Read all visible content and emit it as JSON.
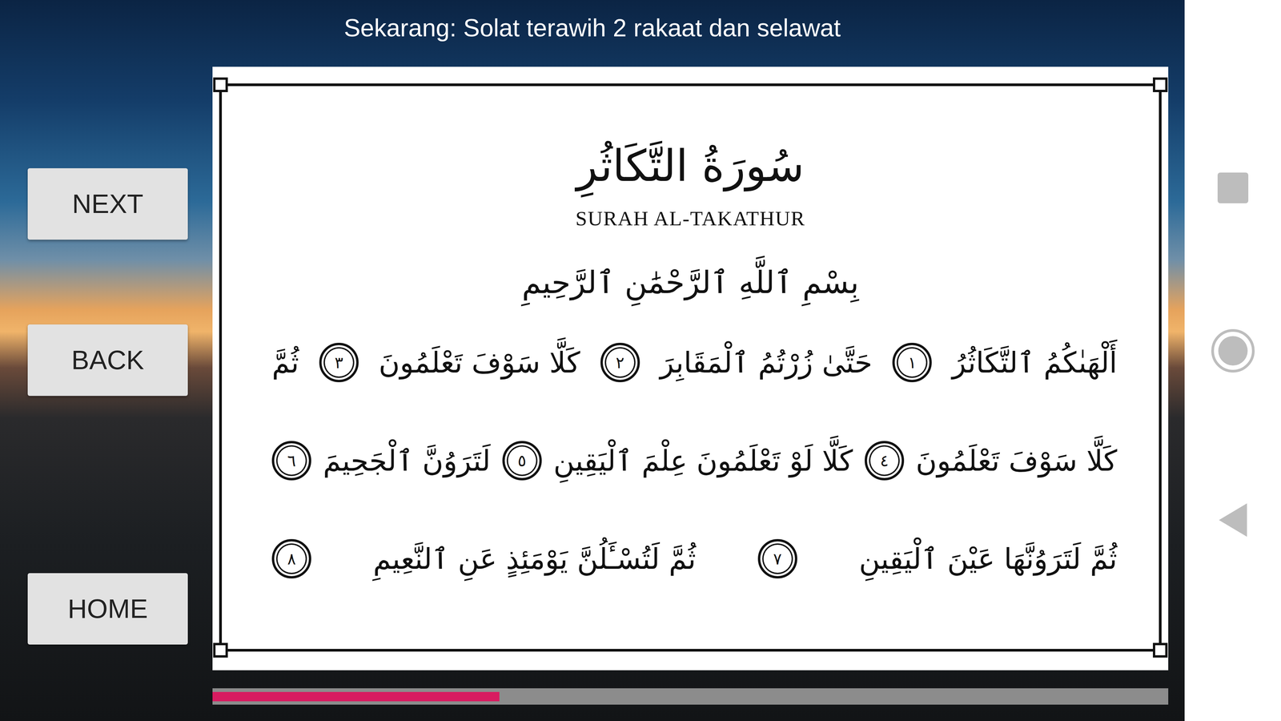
{
  "header": {
    "text": "Sekarang: Solat terawih 2 rakaat dan selawat"
  },
  "buttons": [
    "NEXT",
    "BACK",
    "HOME"
  ],
  "page": {
    "title_arabic": "سُورَةُ التَّكَاثُرِ",
    "title_latin": "SURAH AL-TAKATHUR",
    "basmala": "بِسْمِ ٱللَّهِ ٱلرَّحْمَٰنِ ٱلرَّحِيمِ",
    "lines": [
      [
        {
          "kind": "text",
          "text": "أَلْهَىٰكُمُ ٱلتَّكَاثُرُ"
        },
        {
          "kind": "number",
          "text": "١"
        },
        {
          "kind": "text",
          "text": "حَتَّىٰ زُرْتُمُ ٱلْمَقَابِرَ"
        },
        {
          "kind": "number",
          "text": "٢"
        },
        {
          "kind": "text",
          "text": "كَلَّا سَوْفَ تَعْلَمُونَ"
        },
        {
          "kind": "number",
          "text": "٣"
        },
        {
          "kind": "text",
          "text": "ثُمَّ"
        }
      ],
      [
        {
          "kind": "text",
          "text": "كَلَّا سَوْفَ تَعْلَمُونَ"
        },
        {
          "kind": "number",
          "text": "٤"
        },
        {
          "kind": "text",
          "text": "كَلَّا لَوْ تَعْلَمُونَ عِلْمَ ٱلْيَقِينِ"
        },
        {
          "kind": "number",
          "text": "٥"
        },
        {
          "kind": "text",
          "text": "لَتَرَوُنَّ ٱلْجَحِيمَ"
        },
        {
          "kind": "number",
          "text": "٦"
        }
      ],
      [
        {
          "kind": "text",
          "text": "ثُمَّ لَتَرَوُنَّهَا عَيْنَ ٱلْيَقِينِ"
        },
        {
          "kind": "number",
          "text": "٧"
        },
        {
          "kind": "text",
          "text": "ثُمَّ لَتُسْـَٔلُنَّ يَوْمَئِذٍ عَنِ ٱلنَّعِيمِ"
        },
        {
          "kind": "number",
          "text": "٨"
        }
      ]
    ]
  },
  "progress": {
    "level": 0.3
  }
}
